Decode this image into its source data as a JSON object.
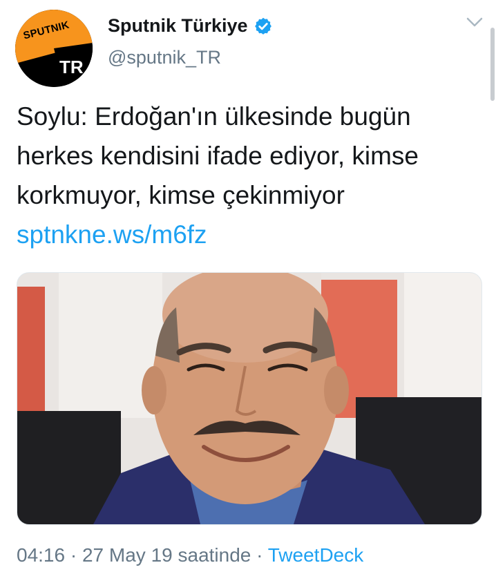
{
  "account": {
    "display_name": "Sputnik Türkiye",
    "handle": "@sputnik_TR",
    "avatar_brand": "SPUTNIK",
    "avatar_tr": "TR",
    "verified_icon": "verified-badge-icon"
  },
  "tweet": {
    "text": "Soylu: Erdoğan'ın ülkesinde bugün herkes kendisini ifade ediyor, kimse korkmuyor, kimse çekinmiyor ",
    "link": "sptnkne.ws/m6fz"
  },
  "meta": {
    "time": "04:16",
    "date_text": "27 May 19 saatinde",
    "separator": " · ",
    "source": "TweetDeck"
  },
  "colors": {
    "link": "#1da1f2",
    "secondary_text": "#657786",
    "avatar_orange": "#f7941d",
    "verified": "#1da1f2"
  }
}
